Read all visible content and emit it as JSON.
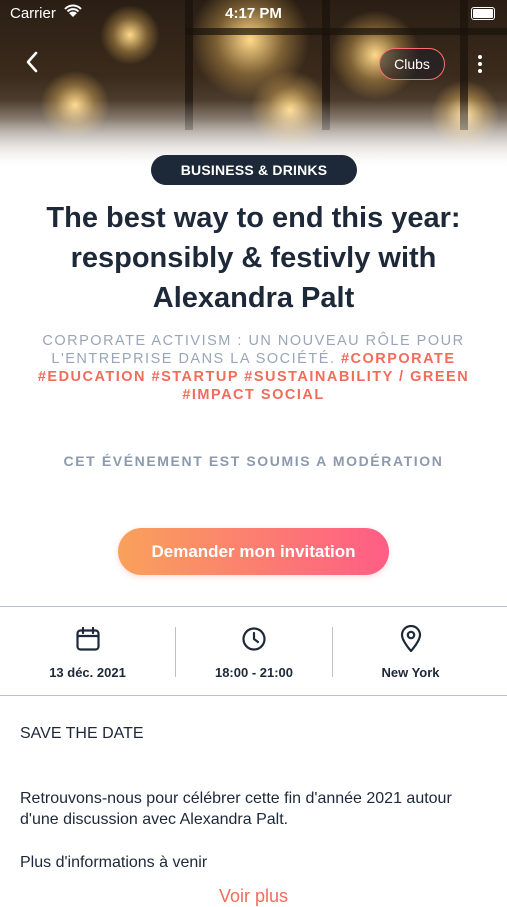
{
  "status_bar": {
    "carrier": "Carrier",
    "time": "4:17 PM"
  },
  "header": {
    "back_icon": "chevron-left-icon",
    "clubs_label": "Clubs",
    "more_icon": "more-vertical-icon"
  },
  "event": {
    "category": "BUSINESS & DRINKS",
    "title": "The best way to end this year: responsibly & festivly with Alexandra Palt",
    "description": "CORPORATE ACTIVISM : UN NOUVEAU RÔLE POUR L'ENTREPRISE DANS LA SOCIÉTÉ.",
    "hashtags": "#CORPORATE #EDUCATION #STARTUP #SUSTAINABILITY / GREEN #IMPACT SOCIAL",
    "moderation_notice": "CET ÉVÉNEMENT EST SOUMIS A MODÉRATION",
    "invite_button": "Demander mon invitation"
  },
  "info": {
    "date": {
      "icon": "calendar-icon",
      "label": "13 déc. 2021"
    },
    "time": {
      "icon": "clock-icon",
      "label": "18:00 - 21:00"
    },
    "location": {
      "icon": "map-pin-icon",
      "label": "New York"
    }
  },
  "details": {
    "heading": "SAVE THE DATE",
    "paragraph1": "Retrouvons-nous pour célébrer cette fin d'année 2021 autour d'une discussion avec Alexandra Palt.",
    "paragraph2": "Plus d'informations à venir",
    "see_more": "Voir plus"
  },
  "colors": {
    "accent": "#f26c5b",
    "navy": "#1d2838",
    "muted": "#9aa6b8",
    "gradient_start": "#f9a15b",
    "gradient_end": "#ff5d86"
  }
}
